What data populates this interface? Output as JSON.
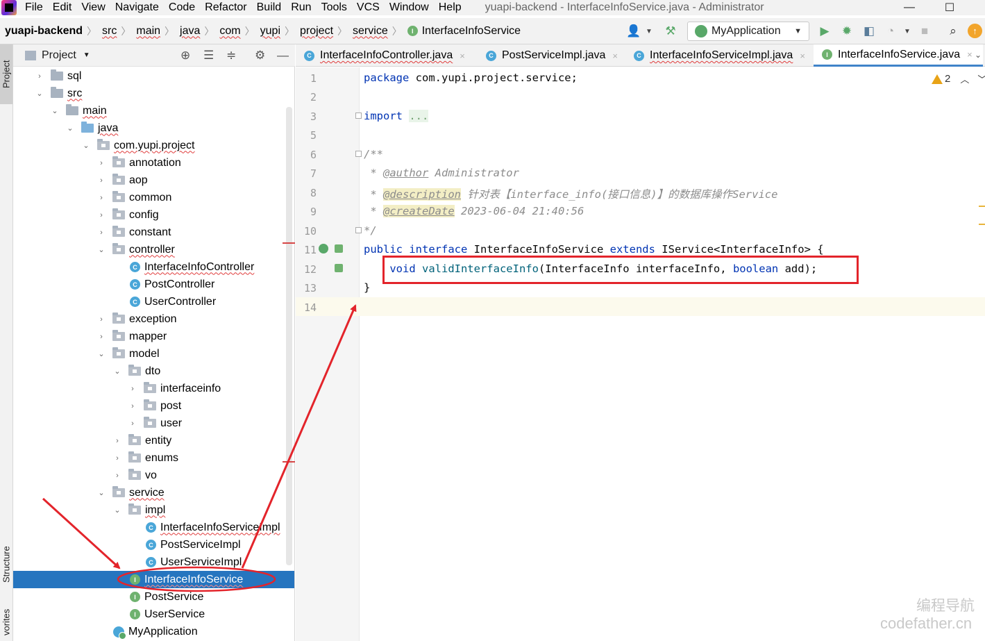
{
  "window": {
    "title": "yuapi-backend - InterfaceInfoService.java - Administrator",
    "minimize": "—",
    "maximize": "☐"
  },
  "menu": [
    "File",
    "Edit",
    "View",
    "Navigate",
    "Code",
    "Refactor",
    "Build",
    "Run",
    "Tools",
    "VCS",
    "Window",
    "Help"
  ],
  "breadcrumbs": {
    "root": "yuapi-backend",
    "items": [
      "src",
      "main",
      "java",
      "com",
      "yupi",
      "project",
      "service"
    ],
    "current": "InterfaceInfoService"
  },
  "toolbar": {
    "run_config": "MyApplication"
  },
  "left_tabs": {
    "project": "Project",
    "structure": "Structure",
    "favorites": "vorites"
  },
  "project_panel": {
    "title": "Project",
    "tree": [
      {
        "label": "sql",
        "icon": "folder-icon"
      },
      {
        "label": "src",
        "icon": "folder-icon"
      },
      {
        "label": "main",
        "icon": "folder-icon"
      },
      {
        "label": "java",
        "icon": "source-folder-icon"
      },
      {
        "label": "com.yupi.project",
        "icon": "package-icon"
      },
      {
        "label": "annotation",
        "icon": "package-icon"
      },
      {
        "label": "aop",
        "icon": "package-icon"
      },
      {
        "label": "common",
        "icon": "package-icon"
      },
      {
        "label": "config",
        "icon": "package-icon"
      },
      {
        "label": "constant",
        "icon": "package-icon"
      },
      {
        "label": "controller",
        "icon": "package-icon"
      },
      {
        "label": "InterfaceInfoController",
        "icon": "class-icon"
      },
      {
        "label": "PostController",
        "icon": "class-icon"
      },
      {
        "label": "UserController",
        "icon": "class-icon"
      },
      {
        "label": "exception",
        "icon": "package-icon"
      },
      {
        "label": "mapper",
        "icon": "package-icon"
      },
      {
        "label": "model",
        "icon": "package-icon"
      },
      {
        "label": "dto",
        "icon": "package-icon"
      },
      {
        "label": "interfaceinfo",
        "icon": "package-icon"
      },
      {
        "label": "post",
        "icon": "package-icon"
      },
      {
        "label": "user",
        "icon": "package-icon"
      },
      {
        "label": "entity",
        "icon": "package-icon"
      },
      {
        "label": "enums",
        "icon": "package-icon"
      },
      {
        "label": "vo",
        "icon": "package-icon"
      },
      {
        "label": "service",
        "icon": "package-icon"
      },
      {
        "label": "impl",
        "icon": "package-icon"
      },
      {
        "label": "InterfaceInfoServiceImpl",
        "icon": "class-icon"
      },
      {
        "label": "PostServiceImpl",
        "icon": "class-icon"
      },
      {
        "label": "UserServiceImpl",
        "icon": "class-icon"
      },
      {
        "label": "InterfaceInfoService",
        "icon": "interface-icon",
        "selected": true
      },
      {
        "label": "PostService",
        "icon": "interface-icon"
      },
      {
        "label": "UserService",
        "icon": "interface-icon"
      },
      {
        "label": "MyApplication",
        "icon": "spring-app-icon"
      }
    ]
  },
  "tabs": [
    {
      "label": "InterfaceInfoController.java",
      "icon": "class-icon",
      "close": "×"
    },
    {
      "label": "PostServiceImpl.java",
      "icon": "class-icon",
      "close": "×"
    },
    {
      "label": "InterfaceInfoServiceImpl.java",
      "icon": "class-icon",
      "close": "×"
    },
    {
      "label": "InterfaceInfoService.java",
      "icon": "interface-icon",
      "close": "×",
      "active": true
    }
  ],
  "editor": {
    "warnings_count": "2",
    "line_numbers": [
      "1",
      "2",
      "3",
      "5",
      "6",
      "7",
      "8",
      "9",
      "10",
      "11",
      "12",
      "13",
      "14"
    ],
    "code": {
      "l1_kw": "package",
      "l1_rest": " com.yupi.project.service;",
      "l3_kw": "import",
      "l3_fold": "...",
      "l6": "/**",
      "l7_star": " * ",
      "l7_tag": "@author",
      "l7_val": " Administrator",
      "l8_star": " * ",
      "l8_tag": "@description",
      "l8_val": " 针对表【interface_info(接口信息)】的数据库操作Service",
      "l9_star": " * ",
      "l9_tag": "@createDate",
      "l9_val": " 2023-06-04 21:40:56",
      "l10": "*/",
      "l11_kw1": "public",
      "l11_kw2": " interface",
      "l11_name": " InterfaceInfoService",
      "l11_kw3": " extends",
      "l11_rest": " IService<InterfaceInfo> {",
      "l12_kw": "    void",
      "l12_fn": " validInterfaceInfo",
      "l12_mid": "(InterfaceInfo interfaceInfo, ",
      "l12_kw2": "boolean",
      "l12_end": " add);",
      "l13": "}"
    }
  },
  "watermark": {
    "line1": "编程导航",
    "line2": "codefather.cn"
  },
  "colors": {
    "selection": "#2675bf",
    "annotation_red": "#e3242b",
    "keyword": "#0033b3",
    "method": "#00627a"
  }
}
